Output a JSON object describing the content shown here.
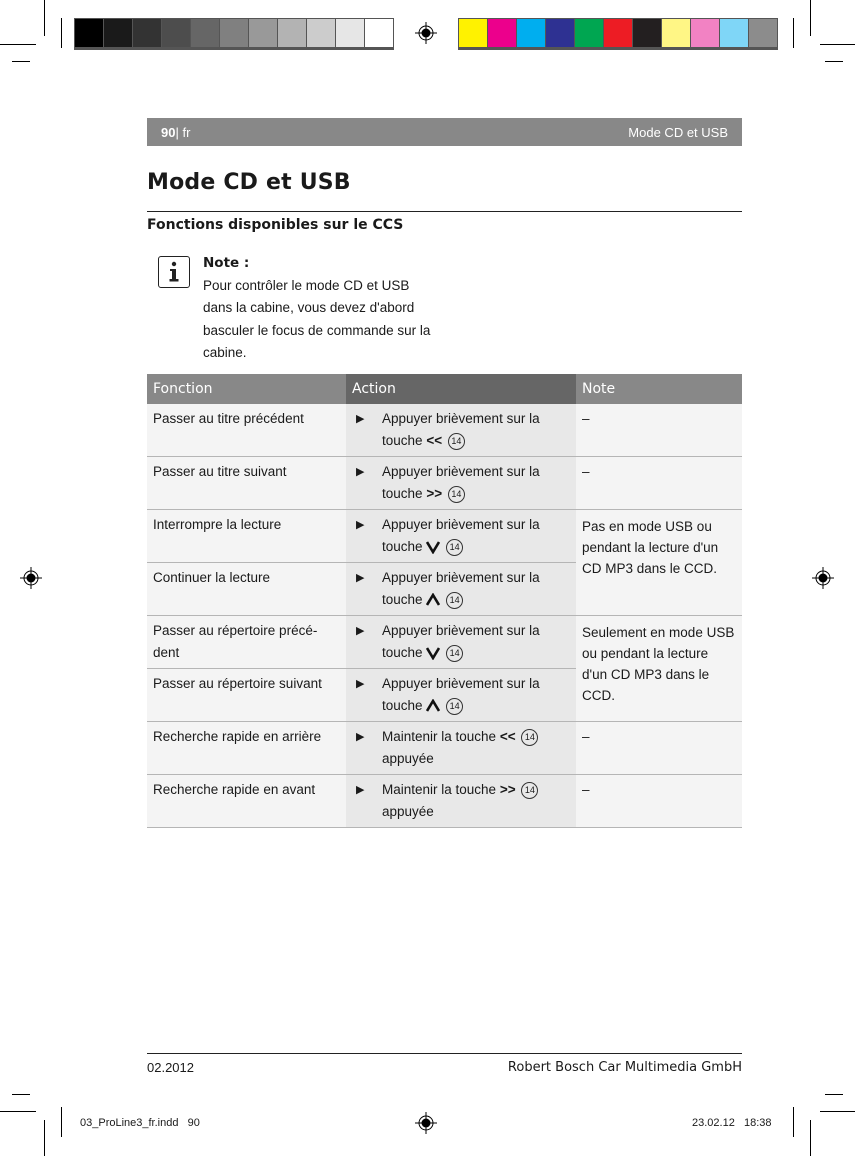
{
  "print_marks": {
    "gray_swatches": [
      "#000000",
      "#1a1a1a",
      "#333333",
      "#4d4d4d",
      "#666666",
      "#808080",
      "#999999",
      "#b3b3b3",
      "#cccccc",
      "#e6e6e6",
      "#ffffff"
    ],
    "color_swatches": [
      "#fff200",
      "#ec008c",
      "#00aeef",
      "#2e3192",
      "#00a651",
      "#ed1c24",
      "#231f20",
      "#fff685",
      "#f282c3",
      "#7fd6f7",
      "#8c8c8c"
    ],
    "slug_left": "03_ProLine3_fr.indd   90",
    "slug_right": "23.02.12   18:38"
  },
  "header": {
    "page_number": "90",
    "language": "| fr",
    "chapter": "Mode CD et USB",
    "band_color": "#888888"
  },
  "page_title": "Mode CD et USB",
  "section_title": "Fonctions disponibles sur le CCS",
  "note": {
    "icon": "info-icon",
    "label": "Note :",
    "lines": [
      "Pour contrôler le mode CD et USB",
      "dans la cabine, vous devez d'abord",
      "basculer le focus de commande sur la",
      "cabine."
    ]
  },
  "table": {
    "headers": [
      "Fonction",
      "Action",
      "Note"
    ],
    "rows": [
      {
        "fonction": "Passer au titre précédent",
        "action_pre": "Appuyer brièvement sur la touche",
        "key": "<<",
        "key_icon": "",
        "ref": "14",
        "action_post": "",
        "note": "–"
      },
      {
        "fonction": "Passer au titre suivant",
        "action_pre": "Appuyer brièvement sur la touche",
        "key": ">>",
        "key_icon": "",
        "ref": "14",
        "action_post": "",
        "note": "–"
      },
      {
        "fonction": "Interrompre la lecture",
        "action_pre": "Appuyer brièvement sur la touche",
        "key": "",
        "key_icon": "chevron-down-icon",
        "ref": "14",
        "action_post": "",
        "note": "Pas en mode USB ou pendant la lecture d'un CD MP3 dans le CCD."
      },
      {
        "fonction": "Continuer la lecture",
        "action_pre": "Appuyer brièvement sur la touche",
        "key": "",
        "key_icon": "chevron-up-icon",
        "ref": "14",
        "action_post": "",
        "note": null
      },
      {
        "fonction": "Passer au répertoire précé-dent",
        "action_pre": "Appuyer brièvement sur la touche",
        "key": "",
        "key_icon": "chevron-down-icon",
        "ref": "14",
        "action_post": "",
        "note": "Seulement en mode USB ou pendant la lecture d'un CD MP3 dans le CCD."
      },
      {
        "fonction": "Passer au répertoire suivant",
        "action_pre": "Appuyer brièvement sur la touche",
        "key": "",
        "key_icon": "chevron-up-icon",
        "ref": "14",
        "action_post": "",
        "note": null
      },
      {
        "fonction": "Recherche rapide en arrière",
        "action_pre": "Maintenir la touche",
        "key": "<<",
        "key_icon": "",
        "ref": "14",
        "action_post": "appuyée",
        "note": "–"
      },
      {
        "fonction": "Recherche rapide en avant",
        "action_pre": "Maintenir la touche",
        "key": ">>",
        "key_icon": "",
        "ref": "14",
        "action_post": "appuyée",
        "note": "–"
      }
    ],
    "bullet": "▶"
  },
  "footer": {
    "date": "02.2012",
    "company": "Robert Bosch Car Multimedia GmbH"
  }
}
